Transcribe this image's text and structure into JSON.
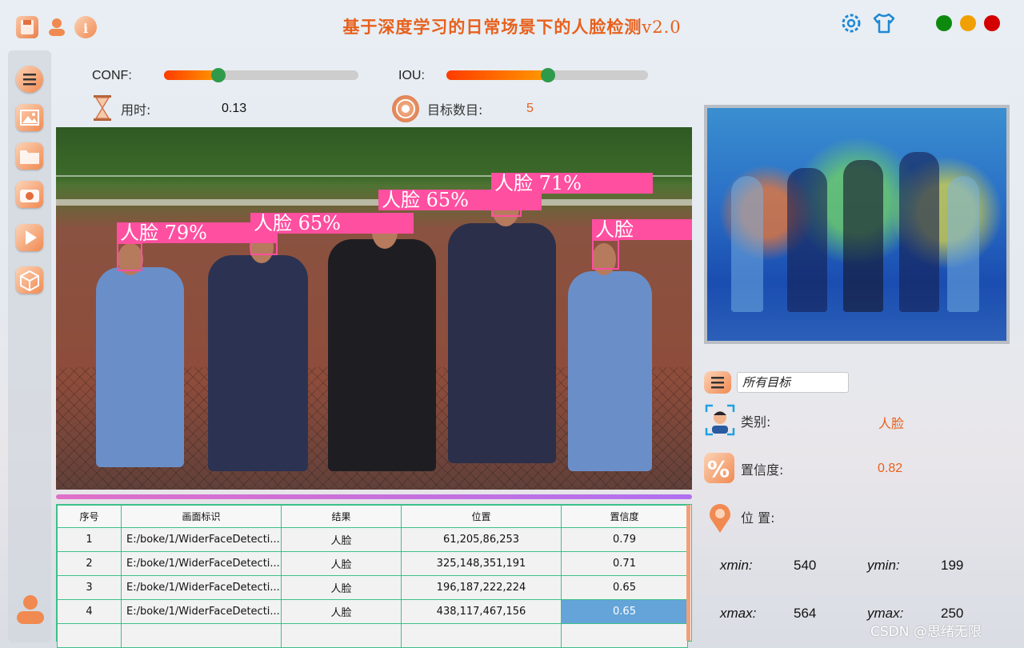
{
  "window": {
    "title": "基于深度学习的日常场景下的人脸检测",
    "version": "v2.0"
  },
  "controls": {
    "conf_label": "CONF:",
    "conf_value": 0.28,
    "iou_label": "IOU:",
    "iou_value": 0.5
  },
  "stats": {
    "time_label": "用时:",
    "time_value": "0.13",
    "count_label": "目标数目:",
    "count_value": "5"
  },
  "detections": [
    {
      "tag": "人脸 79%"
    },
    {
      "tag": "人脸 65%"
    },
    {
      "tag": "人脸 71%"
    },
    {
      "tag": "人脸 65%"
    },
    {
      "tag": "人脸"
    }
  ],
  "table": {
    "headers": [
      "序号",
      "画面标识",
      "结果",
      "位置",
      "置信度"
    ],
    "rows": [
      [
        "1",
        "E:/boke/1/WiderFaceDetecti...",
        "人脸",
        "61,205,86,253",
        "0.79"
      ],
      [
        "2",
        "E:/boke/1/WiderFaceDetecti...",
        "人脸",
        "325,148,351,191",
        "0.71"
      ],
      [
        "3",
        "E:/boke/1/WiderFaceDetecti...",
        "人脸",
        "196,187,222,224",
        "0.65"
      ],
      [
        "4",
        "E:/boke/1/WiderFaceDetecti...",
        "人脸",
        "438,117,467,156",
        "0.65"
      ],
      [
        "",
        "",
        "",
        "",
        ""
      ]
    ]
  },
  "detail": {
    "target_select": "所有目标",
    "class_label": "类别:",
    "class_value": "人脸",
    "conf_label": "置信度:",
    "conf_value": "0.82",
    "pos_label": "位 置:",
    "xmin_label": "xmin:",
    "xmin_value": "540",
    "ymin_label": "ymin:",
    "ymin_value": "199",
    "xmax_label": "xmax:",
    "xmax_value": "564",
    "ymax_label": "ymax:",
    "ymax_value": "250"
  },
  "watermark": "CSDN @思绪无限",
  "colors": {
    "accent": "#e8601c",
    "table_border": "#3cc08a",
    "face_box": "#ff4fa0",
    "selected_cell": "#64a4d8"
  }
}
